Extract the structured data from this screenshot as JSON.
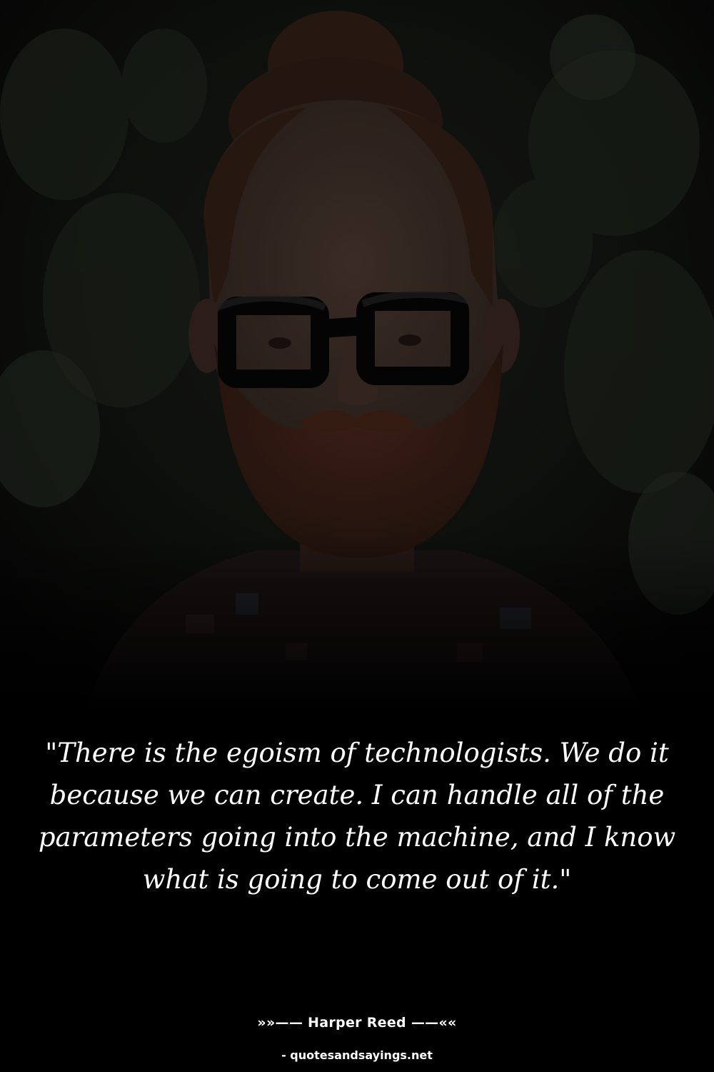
{
  "quote": {
    "text": "\"There is the egoism of technologists. We do it because we can create. I can handle all of the parameters going into the machine, and I know what is going to come out of it.\"",
    "author_line": "»»—— Harper Reed ——««",
    "source": "- quotesandsayings.net"
  },
  "photo": {
    "subject_icon": "portrait-photo",
    "colors": {
      "background": "#000000",
      "foliage": "#131712",
      "skin": "#3a2c26",
      "beard": "#3a1f15",
      "hair": "#2d1d15",
      "glasses": "#050505",
      "text": "#ffffff"
    }
  }
}
